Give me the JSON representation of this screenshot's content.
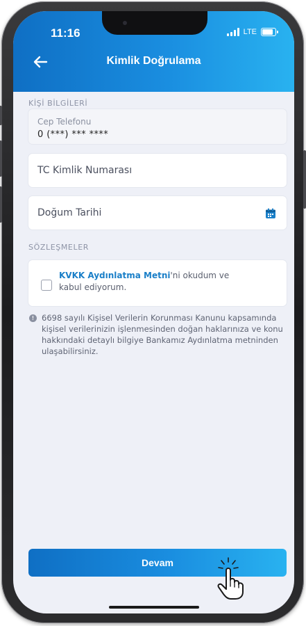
{
  "status_bar": {
    "time": "11:16",
    "network": "LTE"
  },
  "header": {
    "title": "Kimlik Doğrulama"
  },
  "personal_info": {
    "section_title": "KİŞİ BİLGİLERİ",
    "phone_label": "Cep Telefonu",
    "phone_value": "0 (***) *** ****",
    "tc_placeholder": "TC Kimlik Numarası",
    "birth_placeholder": "Doğum Tarihi"
  },
  "agreements": {
    "section_title": "SÖZLEŞMELER",
    "consent_link": "KVKK Aydınlatma Metni",
    "consent_text": "'ni okudum ve kabul ediyorum."
  },
  "info_note": "6698 sayılı Kişisel Verilerin Korunması Kanunu kapsamında kişisel verilerinizin işlenmesinden doğan haklarınıza ve konu hakkındaki detaylı bilgiye Bankamız Aydınlatma metninden ulaşabilirsiniz.",
  "actions": {
    "continue_label": "Devam"
  },
  "colors": {
    "brand_start": "#0f6fc4",
    "brand_end": "#29b2f0",
    "background": "#eef0f7"
  },
  "icons": [
    "back-arrow-icon",
    "calendar-icon",
    "info-icon",
    "tap-hand-icon",
    "signal-icon",
    "battery-icon"
  ]
}
